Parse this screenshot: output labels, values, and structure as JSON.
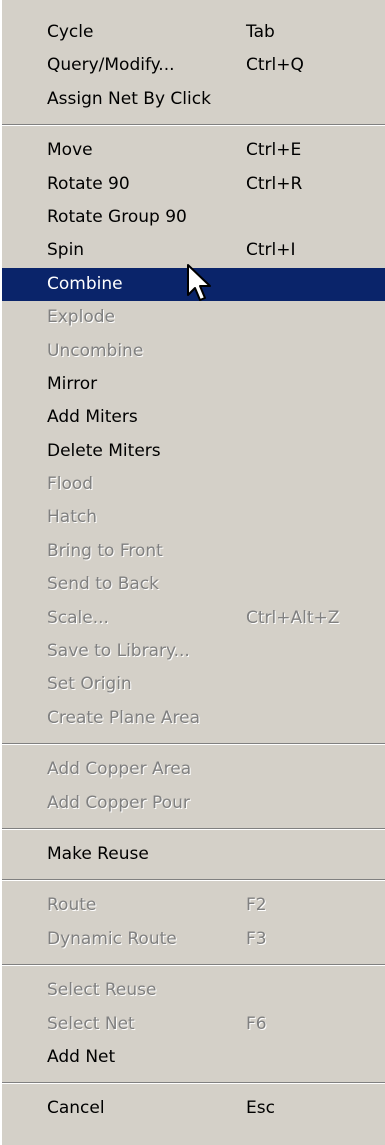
{
  "menu": {
    "groups": [
      [
        {
          "label": "Cycle",
          "shortcut": "Tab"
        },
        {
          "label": "Query/Modify...",
          "shortcut": "Ctrl+Q"
        },
        {
          "label": "Assign Net By Click",
          "shortcut": ""
        }
      ],
      [
        {
          "label": "Move",
          "shortcut": "Ctrl+E"
        },
        {
          "label": "Rotate 90",
          "shortcut": "Ctrl+R"
        },
        {
          "label": "Rotate Group 90",
          "shortcut": ""
        },
        {
          "label": "Spin",
          "shortcut": "Ctrl+I"
        },
        {
          "label": "Combine",
          "shortcut": "",
          "highlighted": true
        },
        {
          "label": "Explode",
          "shortcut": "",
          "disabled": true
        },
        {
          "label": "Uncombine",
          "shortcut": "",
          "disabled": true
        },
        {
          "label": "Mirror",
          "shortcut": ""
        },
        {
          "label": "Add Miters",
          "shortcut": ""
        },
        {
          "label": "Delete Miters",
          "shortcut": ""
        },
        {
          "label": "Flood",
          "shortcut": "",
          "disabled": true
        },
        {
          "label": "Hatch",
          "shortcut": "",
          "disabled": true
        },
        {
          "label": "Bring to Front",
          "shortcut": "",
          "disabled": true
        },
        {
          "label": "Send to Back",
          "shortcut": "",
          "disabled": true
        },
        {
          "label": "Scale...",
          "shortcut": "Ctrl+Alt+Z",
          "disabled": true
        },
        {
          "label": "Save to Library...",
          "shortcut": "",
          "disabled": true
        },
        {
          "label": "Set Origin",
          "shortcut": "",
          "disabled": true
        },
        {
          "label": "Create Plane Area",
          "shortcut": "",
          "disabled": true
        }
      ],
      [
        {
          "label": "Add Copper Area",
          "shortcut": "",
          "disabled": true
        },
        {
          "label": "Add Copper Pour",
          "shortcut": "",
          "disabled": true
        }
      ],
      [
        {
          "label": "Make Reuse",
          "shortcut": ""
        }
      ],
      [
        {
          "label": "Route",
          "shortcut": "F2",
          "disabled": true
        },
        {
          "label": "Dynamic Route",
          "shortcut": "F3",
          "disabled": true
        }
      ],
      [
        {
          "label": "Select Reuse",
          "shortcut": "",
          "disabled": true
        },
        {
          "label": "Select Net",
          "shortcut": "F6",
          "disabled": true
        },
        {
          "label": "Add Net",
          "shortcut": ""
        }
      ],
      [
        {
          "label": "Cancel",
          "shortcut": "Esc"
        }
      ]
    ]
  },
  "colors": {
    "menu_background": "#d4d0c8",
    "highlight": "#0a246a",
    "disabled_text": "#808080"
  },
  "icons": {
    "cursor": "arrow-pointer-icon"
  }
}
